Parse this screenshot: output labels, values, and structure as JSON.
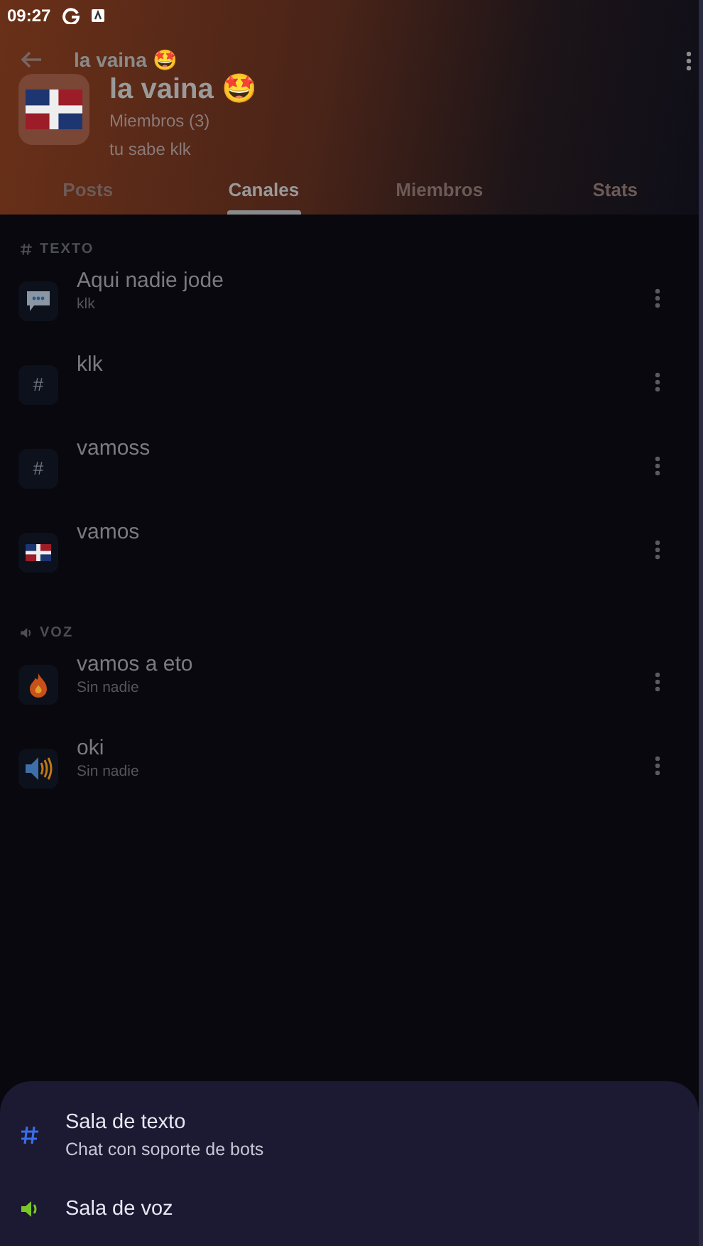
{
  "status_bar": {
    "time": "09:27"
  },
  "header": {
    "toolbar_title": "la vaina 🤩",
    "title": "la vaina 🤩",
    "members": "Miembros (3)",
    "description": "tu sabe klk"
  },
  "tabs": [
    {
      "label": "Posts",
      "selected": false
    },
    {
      "label": "Canales",
      "selected": true
    },
    {
      "label": "Miembros",
      "selected": false
    },
    {
      "label": "Stats",
      "selected": false
    }
  ],
  "sections": [
    {
      "kind": "text",
      "title": "TEXTO",
      "channels": [
        {
          "kind": "chat",
          "name": "Aqui nadie jode",
          "subtitle": "klk"
        },
        {
          "kind": "hash",
          "icon_text": "#",
          "name": "klk"
        },
        {
          "kind": "hash",
          "icon_text": "#",
          "name": "vamoss"
        },
        {
          "kind": "flag",
          "name": "vamos"
        }
      ]
    },
    {
      "kind": "voice",
      "title": "VOZ",
      "channels": [
        {
          "kind": "fire",
          "name": "vamos a eto",
          "subtitle": "Sin nadie"
        },
        {
          "kind": "speaker",
          "name": "oki",
          "subtitle": "Sin nadie"
        }
      ]
    }
  ],
  "sheet": [
    {
      "kind": "text",
      "title": "Sala de texto",
      "subtitle": "Chat con soporte de bots"
    },
    {
      "kind": "voice",
      "title": "Sala de voz"
    }
  ]
}
